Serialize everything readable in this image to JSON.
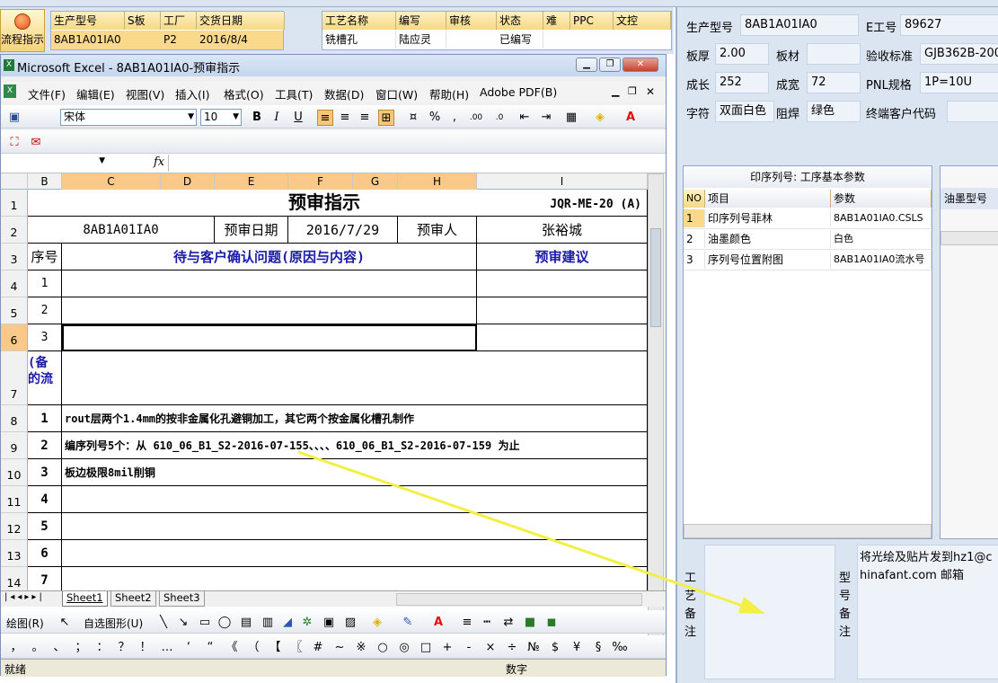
{
  "bg_app": {
    "flow_button_label": "流程指示",
    "order_grid": {
      "headers": [
        "生产型号",
        "S板",
        "工厂",
        "交货日期"
      ],
      "row": [
        "8AB1A01IA0",
        "",
        "P2",
        "2016/8/4"
      ]
    },
    "process_grid": {
      "headers": [
        "工艺名称",
        "编写",
        "审核",
        "状态",
        "难",
        "PPC",
        "文控"
      ],
      "row": [
        "铣槽孔",
        "陆应灵",
        "",
        "已编写",
        "",
        "",
        ""
      ]
    }
  },
  "excel": {
    "window_title": "Microsoft Excel - 8AB1A01IA0-预审指示",
    "menus": [
      "文件(F)",
      "编辑(E)",
      "视图(V)",
      "插入(I)",
      "格式(O)",
      "工具(T)",
      "数据(D)",
      "窗口(W)",
      "帮助(H)",
      "Adobe PDF(B)"
    ],
    "font_name": "宋体",
    "font_size": "10",
    "fx_label": "fx",
    "columns": [
      "B",
      "C",
      "D",
      "E",
      "F",
      "G",
      "H",
      "I"
    ],
    "rows": [
      "1",
      "2",
      "3",
      "4",
      "5",
      "6",
      "7",
      "8",
      "9",
      "10",
      "11",
      "12",
      "13",
      "14"
    ],
    "sheet": {
      "title": "预审指示",
      "doc_code": "JQR-ME-20 (A)",
      "model": "8AB1A01IA0",
      "review_date_label": "预审日期",
      "review_date": "2016/7/29",
      "reviewer_label": "预审人",
      "reviewer": "张裕城",
      "seq_label": "序号",
      "issue_header": "待与客户确认问题(原因与内容)",
      "suggest_header": "预审建议",
      "issue_rows": [
        "1",
        "2",
        "3"
      ],
      "section_label_1": "(备",
      "section_label_2": "的流",
      "notes": [
        {
          "no": "1",
          "text": "rout层两个1.4mm的按非金属化孔避铜加工，其它两个按金属化槽孔制作"
        },
        {
          "no": "2",
          "text": "编序列号5个：从 610_06_B1_S2-2016-07-155、、、、610_06_B1_S2-2016-07-159 为止"
        },
        {
          "no": "3",
          "text": "板边极限8mil削铜"
        },
        {
          "no": "4",
          "text": ""
        },
        {
          "no": "5",
          "text": ""
        },
        {
          "no": "6",
          "text": ""
        },
        {
          "no": "7",
          "text": ""
        }
      ]
    },
    "sheet_tabs": [
      "Sheet1",
      "Sheet2",
      "Sheet3"
    ],
    "drawing_toolbar": {
      "draw": "绘图(R)",
      "autoshape": "自选图形(U)"
    },
    "symbols": [
      "，",
      "。",
      "、",
      "；",
      "：",
      "？",
      "！",
      "…",
      "‘",
      "“",
      "《",
      "（",
      "【",
      "〖",
      "#",
      "~",
      "※",
      "○",
      "◎",
      "□",
      "+",
      "-",
      "×",
      "÷",
      "№",
      "$",
      "¥",
      "§",
      "‰"
    ],
    "status_ready": "就绪",
    "status_num": "数字"
  },
  "right_panel": {
    "fields": [
      {
        "label": "生产型号",
        "value": "8AB1A01IA0"
      },
      {
        "label": "E工号",
        "value": "89627"
      },
      {
        "label": "板厚",
        "value": "2.00"
      },
      {
        "label": "板材",
        "value": ""
      },
      {
        "label": "验收标准",
        "value": "GJB362B-200"
      },
      {
        "label": "成长",
        "value": "252"
      },
      {
        "label": "成宽",
        "value": "72"
      },
      {
        "label": "PNL规格",
        "value": "1P=10U"
      },
      {
        "label": "字符",
        "value": "双面白色"
      },
      {
        "label": "阻焊",
        "value": "绿色"
      },
      {
        "label": "终端客户代码",
        "value": ""
      }
    ],
    "param_table": {
      "caption": "印序列号: 工序基本参数",
      "headers": [
        "NO",
        "项目",
        "参数"
      ],
      "rows": [
        [
          "1",
          "印序列号菲林",
          "8AB1A01IA0.CSLS"
        ],
        [
          "2",
          "油墨颜色",
          "白色"
        ],
        [
          "3",
          "序列号位置附图",
          "8AB1A01IA0流水号"
        ]
      ]
    },
    "ink_header": "油墨型号",
    "process_notes_label": "工艺备注",
    "model_notes_label": "型号备注",
    "model_notes_text": "将光绘及贴片发到hz1@chinafant.com 邮箱"
  }
}
